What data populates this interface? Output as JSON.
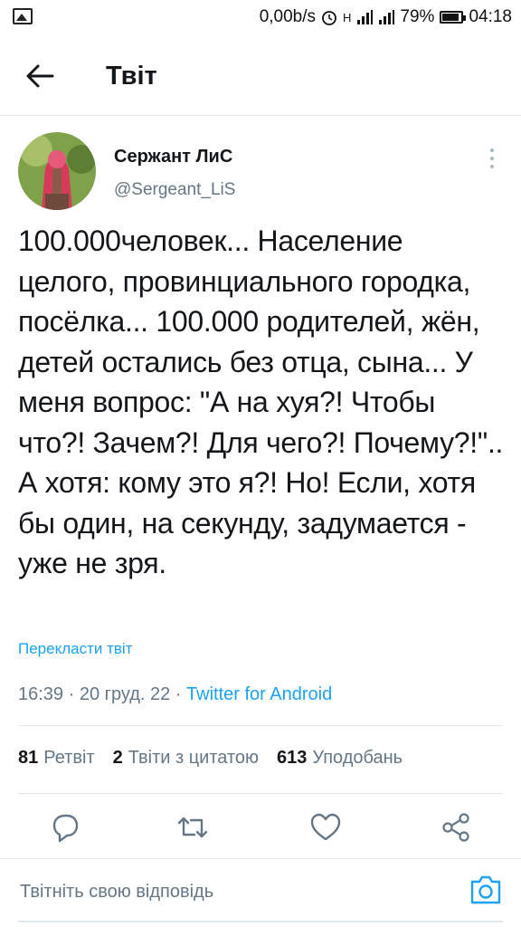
{
  "status_bar": {
    "net_speed": "0,00b/s",
    "network": "H",
    "battery": "79%",
    "time": "04:18",
    "icons": [
      "image-icon",
      "alarm-icon",
      "signal-icon",
      "signal-icon",
      "battery-icon"
    ]
  },
  "header": {
    "title": "Твіт",
    "back_icon": "arrow-left-icon"
  },
  "tweet": {
    "author_name": "Сержант ЛиС",
    "author_handle": "@Sergeant_LiS",
    "text": "100.000человек... Население целого, провинциального городка, посёлка... 100.000 родителей, жён, детей остались без отца, сына... У меня вопрос: \"А на хуя?! Чтобы что?! Зачем?! Для чего?! Почему?!\".. А хотя: кому это я?! Но! Если, хотя бы один, на секунду, задумается - уже не зря.",
    "translate_label": "Перекласти твіт",
    "time": "16:39",
    "date": "20 груд. 22",
    "source": "Twitter for Android",
    "separator": "·"
  },
  "stats": {
    "retweets_count": "81",
    "retweets_label": "Ретвіт",
    "quotes_count": "2",
    "quotes_label": "Твіти з цитатою",
    "likes_count": "613",
    "likes_label": "Уподобань"
  },
  "actions": [
    "reply-icon",
    "retweet-icon",
    "like-icon",
    "share-icon"
  ],
  "reply": {
    "placeholder": "Твітніть свою відповідь",
    "camera_icon": "camera-icon"
  },
  "colors": {
    "accent": "#1da1f2",
    "secondary_text": "#657786",
    "primary_text": "#14171a",
    "border": "#e1e8ed"
  }
}
